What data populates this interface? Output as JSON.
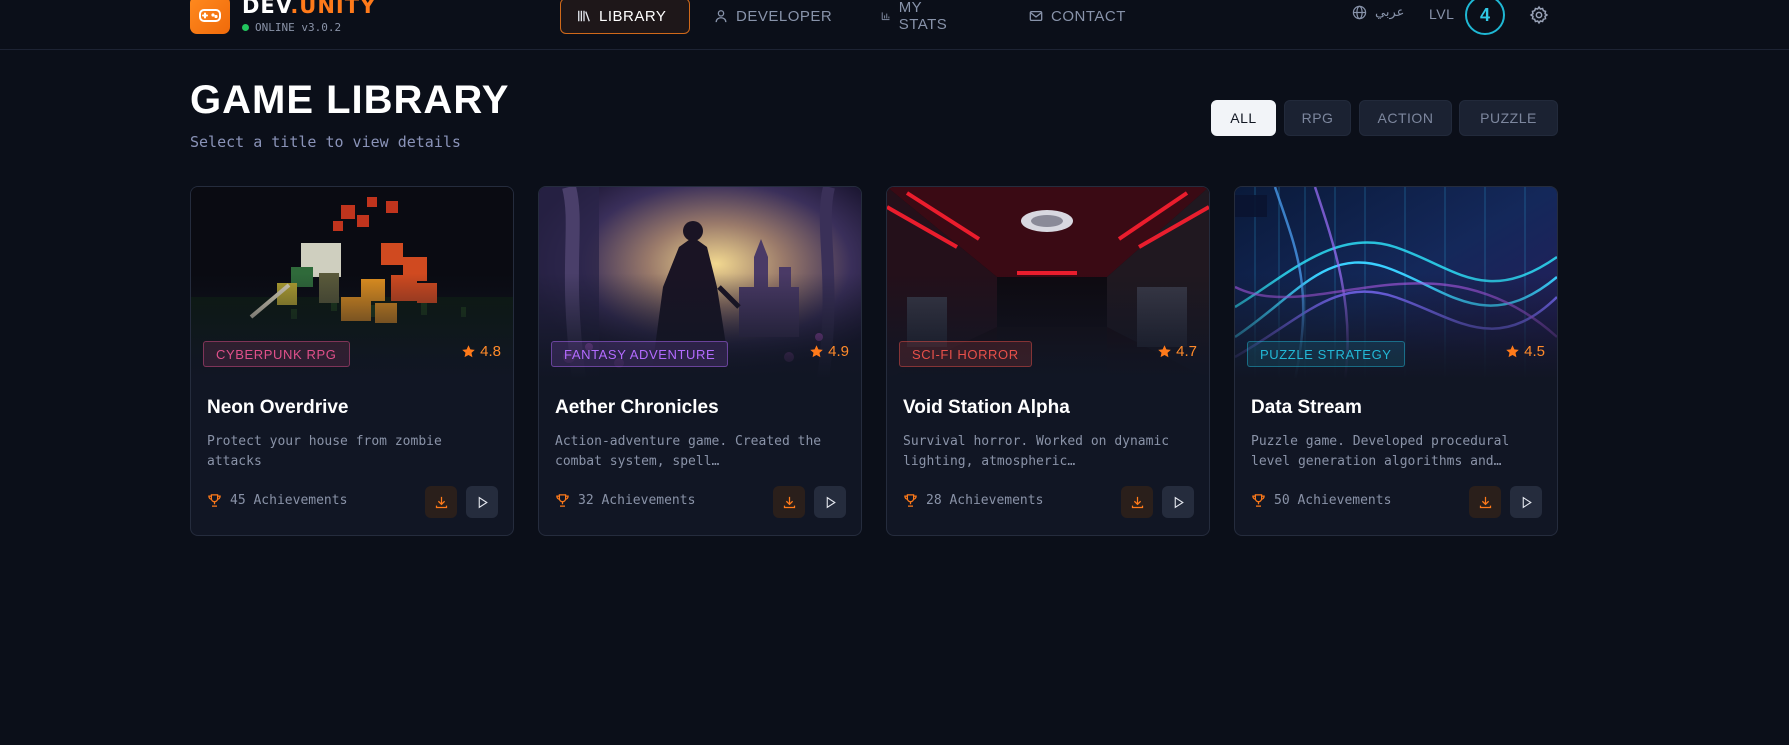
{
  "header": {
    "brand_main": "DEV",
    "brand_accent": ".UNITY",
    "status": "ONLINE v3.0.2",
    "nav": [
      {
        "label": "LIBRARY",
        "icon": "library-icon",
        "active": true
      },
      {
        "label": "DEVELOPER",
        "icon": "user-icon",
        "active": false
      },
      {
        "label": "MY STATS",
        "icon": "bar-chart-icon",
        "active": false
      },
      {
        "label": "CONTACT",
        "icon": "mail-icon",
        "active": false
      }
    ],
    "language": "عربي",
    "level_label": "LVL",
    "level": "4"
  },
  "main": {
    "title": "GAME LIBRARY",
    "subtitle": "Select a title to view details",
    "filters": [
      {
        "label": "ALL",
        "active": true
      },
      {
        "label": "RPG",
        "active": false
      },
      {
        "label": "ACTION",
        "active": false
      },
      {
        "label": "PUZZLE",
        "active": false
      }
    ]
  },
  "games": [
    {
      "title": "Neon Overdrive",
      "genre": "CYBERPUNK RPG",
      "rating": "4.8",
      "description": "Protect your house from zombie attacks",
      "achievements": "45 Achievements",
      "genre_color": "#e0508a"
    },
    {
      "title": "Aether Chronicles",
      "genre": "FANTASY ADVENTURE",
      "rating": "4.9",
      "description": "Action-adventure game. Created the combat system, spell…",
      "achievements": "32 Achievements",
      "genre_color": "#b36bff"
    },
    {
      "title": "Void Station Alpha",
      "genre": "SCI-FI HORROR",
      "rating": "4.7",
      "description": "Survival horror. Worked on dynamic lighting, atmospheric…",
      "achievements": "28 Achievements",
      "genre_color": "#e8504a"
    },
    {
      "title": "Data Stream",
      "genre": "PUZZLE STRATEGY",
      "rating": "4.5",
      "description": "Puzzle game. Developed procedural level generation algorithms and…",
      "achievements": "50 Achievements",
      "genre_color": "#22b8d6"
    }
  ],
  "colors": {
    "accent": "#ff7a1a",
    "level_ring": "#1fb8d4",
    "background": "#0b0f19"
  }
}
